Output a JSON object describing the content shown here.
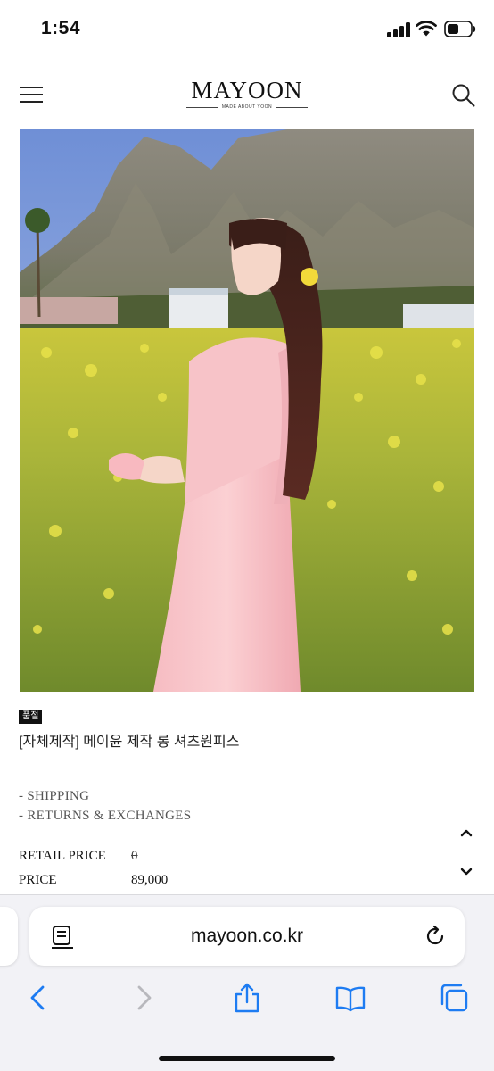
{
  "status_bar": {
    "time": "1:54"
  },
  "header": {
    "logo": "MAYOON",
    "logo_subtitle": "MADE ABOUT YOON"
  },
  "product": {
    "badge": "품절",
    "name": "[자체제작] 메이윤 제작 롱 셔츠원피스",
    "links": [
      "- SHIPPING",
      "- RETURNS & EXCHANGES"
    ],
    "retail_price_label": "RETAIL PRICE",
    "retail_price_value": "0",
    "price_label": "PRICE",
    "price_value": "89,000"
  },
  "browser": {
    "url": "mayoon.co.kr"
  },
  "icons": [
    "menu-icon",
    "search-icon",
    "chevron-up-icon",
    "chevron-down-icon",
    "reader-icon",
    "reload-icon",
    "back-icon",
    "forward-icon",
    "share-icon",
    "bookmarks-icon",
    "tabs-icon"
  ],
  "colors": {
    "accent_blue": "#1e7cf2",
    "disabled_gray": "#b8b8bd",
    "background": "#ffffff",
    "toolbar_bg": "#f2f2f6"
  }
}
